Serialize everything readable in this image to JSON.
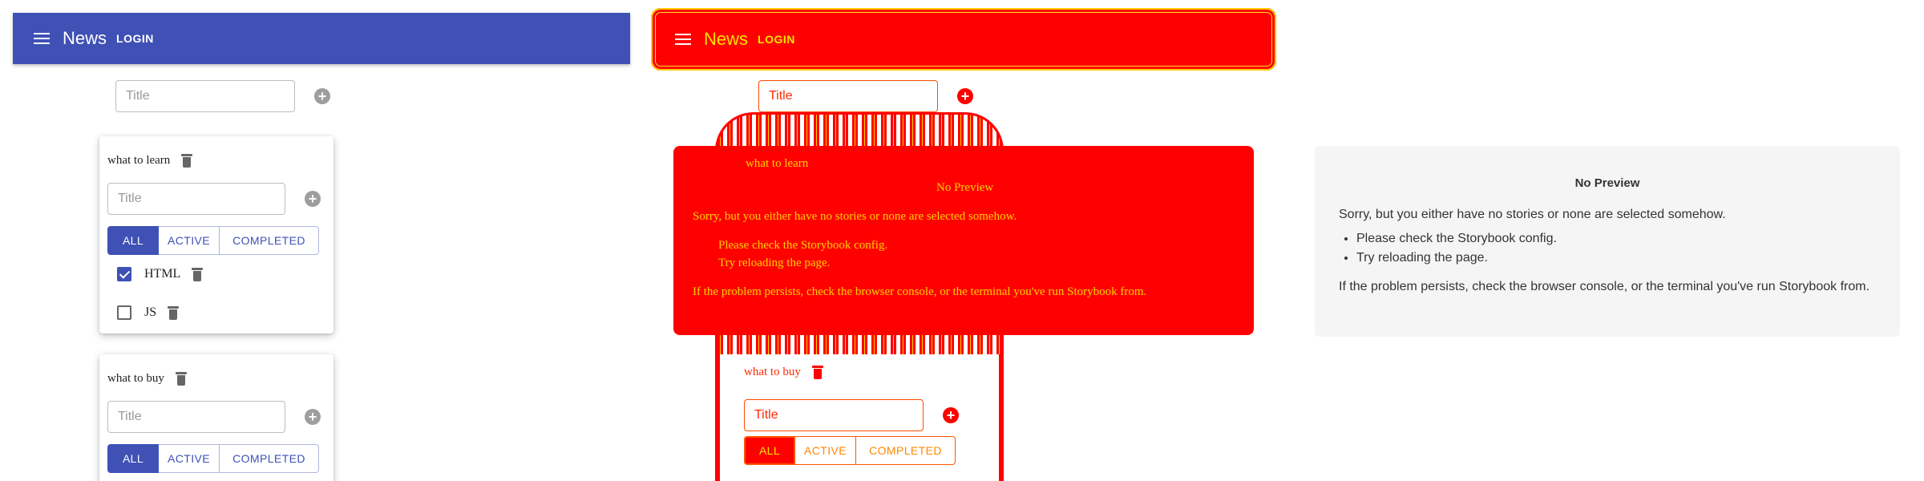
{
  "app": {
    "title": "News",
    "login_label": "LOGIN"
  },
  "add_form": {
    "placeholder": "Title"
  },
  "filters": {
    "all": "ALL",
    "active": "ACTIVE",
    "completed": "COMPLETED"
  },
  "todolists": [
    {
      "title": "what to learn",
      "tasks": [
        {
          "title": "HTML",
          "done": true
        },
        {
          "title": "JS",
          "done": false
        }
      ]
    },
    {
      "title": "what to buy",
      "tasks": []
    }
  ],
  "no_preview": {
    "title": "No Preview",
    "body": "Sorry, but you either have no stories or none are selected somehow.",
    "items": [
      "Please check the Storybook config.",
      "Try reloading the page."
    ],
    "footer": "If the problem persists, check the browser console, or the terminal you've run Storybook from."
  },
  "colors": {
    "primary": "#3f51b5",
    "diff_red": "#ff0000",
    "diff_yellow": "#ffd000",
    "muted": "#9e9e9e"
  }
}
